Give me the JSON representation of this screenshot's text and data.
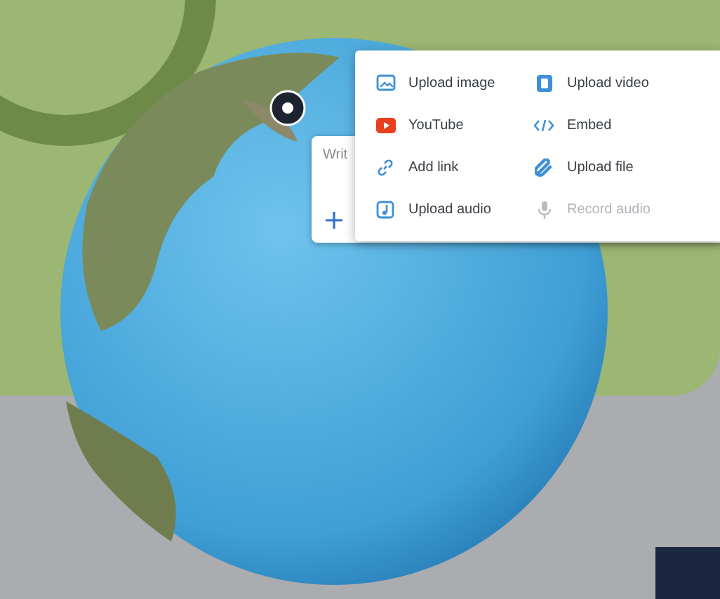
{
  "editor": {
    "placeholder": "Writ"
  },
  "menu": {
    "items": [
      {
        "label": "Upload image",
        "kind": "image",
        "disabled": false
      },
      {
        "label": "Upload video",
        "kind": "video",
        "disabled": false
      },
      {
        "label": "YouTube",
        "kind": "youtube",
        "disabled": false
      },
      {
        "label": "Embed",
        "kind": "embed",
        "disabled": false
      },
      {
        "label": "Add link",
        "kind": "link",
        "disabled": false
      },
      {
        "label": "Upload file",
        "kind": "file",
        "disabled": false
      },
      {
        "label": "Upload audio",
        "kind": "audio",
        "disabled": false
      },
      {
        "label": "Record audio",
        "kind": "mic",
        "disabled": true
      }
    ]
  }
}
